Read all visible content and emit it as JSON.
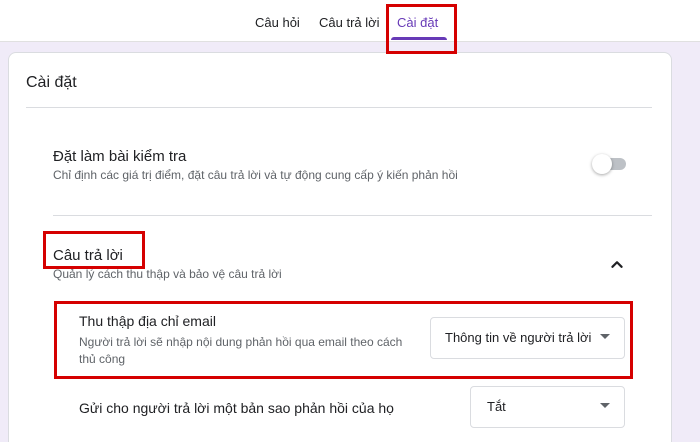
{
  "tabs": [
    {
      "label": "Câu hỏi"
    },
    {
      "label": "Câu trả lời"
    },
    {
      "label": "Cài đặt",
      "active": true
    }
  ],
  "card": {
    "title": "Cài đặt",
    "quiz": {
      "title": "Đặt làm bài kiểm tra",
      "description": "Chỉ định các giá trị điểm, đặt câu trả lời và tự động cung cấp ý kiến phản hồi",
      "enabled": false
    },
    "responses": {
      "title": "Câu trả lời",
      "description": "Quản lý cách thu thập và bảo vệ câu trả lời",
      "expanded": true,
      "collect_email": {
        "title": "Thu thập địa chỉ email",
        "description_line1": "Người trả lời sẽ nhập nội dung phản hồi qua email theo cách",
        "description_line2": "thủ công",
        "selected": "Thông tin về người trả lời"
      },
      "send_copy": {
        "title": "Gửi cho người trả lời một bản sao phản hồi của họ",
        "selected": "Tắt"
      }
    }
  },
  "colors": {
    "accent": "#673ab7",
    "highlight": "#d50000",
    "background": "#f0ebf8"
  },
  "icons": [
    "chevron-up-icon",
    "dropdown-arrow-icon"
  ]
}
